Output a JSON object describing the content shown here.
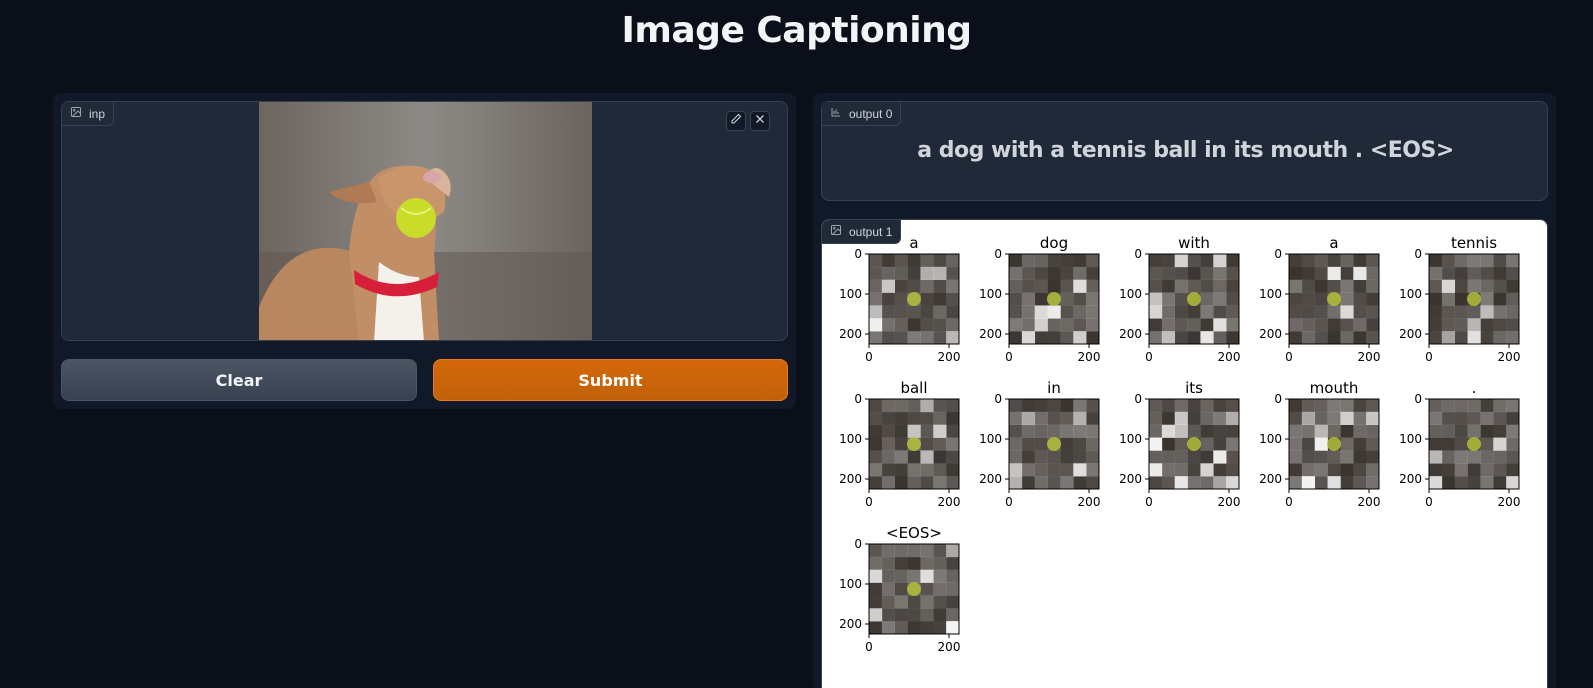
{
  "title": "Image Captioning",
  "input": {
    "label": "inp"
  },
  "buttons": {
    "clear": "Clear",
    "submit": "Submit"
  },
  "output0": {
    "label": "output 0",
    "caption": "a dog with a tennis ball in its mouth . <EOS>"
  },
  "output1": {
    "label": "output 1"
  },
  "attention_grid": {
    "words": [
      "a",
      "dog",
      "with",
      "a",
      "tennis",
      "ball",
      "in",
      "its",
      "mouth",
      ".",
      "<EOS>"
    ],
    "y_ticks": [
      "0",
      "100",
      "200"
    ],
    "x_ticks": [
      "0",
      "200"
    ]
  },
  "colors": {
    "accent": "#c2610a",
    "background": "#0b0f19",
    "panel": "#111827"
  }
}
